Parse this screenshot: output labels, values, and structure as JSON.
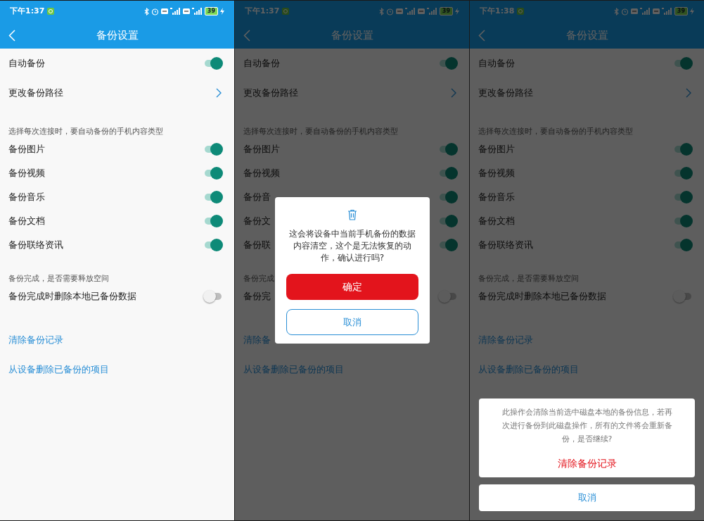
{
  "screens": [
    {
      "status_bar": {
        "time": "下午1:37",
        "icons": [
          {
            "kind": "bluetooth"
          },
          {
            "kind": "alarm"
          },
          {
            "kind": "hd"
          },
          {
            "kind": "signal"
          },
          {
            "kind": "hd"
          },
          {
            "kind": "signal"
          }
        ],
        "battery": "39"
      },
      "title": "备份设置",
      "dimmed": false,
      "rows": [
        {
          "kind": "toggle",
          "label": "自动备份",
          "on": true
        },
        {
          "kind": "nav",
          "label": "更改备份路径"
        },
        {
          "kind": "caption",
          "label": "选择每次连接时，要自动备份的手机内容类型"
        },
        {
          "kind": "toggle",
          "label": "备份图片",
          "on": true
        },
        {
          "kind": "toggle",
          "label": "备份视频",
          "on": true
        },
        {
          "kind": "toggle",
          "label": "备份音乐",
          "on": true
        },
        {
          "kind": "toggle",
          "label": "备份文档",
          "on": true
        },
        {
          "kind": "toggle",
          "label": "备份联络资讯",
          "on": true
        },
        {
          "kind": "caption",
          "label": "备份完成，是否需要释放空间"
        },
        {
          "kind": "toggle",
          "label": "备份完成时删除本地已备份数据",
          "on": false
        },
        {
          "kind": "action",
          "label": "清除备份记录"
        },
        {
          "kind": "action",
          "label": "从设备删除已备份的项目"
        }
      ],
      "overlay": {
        "kind": "none"
      }
    },
    {
      "status_bar": {
        "time": "下午1:37",
        "icons": [
          {
            "kind": "bluetooth"
          },
          {
            "kind": "alarm"
          },
          {
            "kind": "hd"
          },
          {
            "kind": "signal"
          },
          {
            "kind": "hd"
          },
          {
            "kind": "signal"
          }
        ],
        "battery": "39"
      },
      "title": "备份设置",
      "dimmed": true,
      "rows": [
        {
          "kind": "toggle",
          "label": "自动备份",
          "on": true
        },
        {
          "kind": "nav",
          "label": "更改备份路径"
        },
        {
          "kind": "caption",
          "label": "选择每次连接时，要自动备份的手机内容类型"
        },
        {
          "kind": "toggle",
          "label": "备份图片",
          "on": true
        },
        {
          "kind": "toggle",
          "label": "备份视频",
          "on": true
        },
        {
          "kind": "toggle",
          "label": "备份音",
          "on": true
        },
        {
          "kind": "toggle",
          "label": "备份文",
          "on": true
        },
        {
          "kind": "toggle",
          "label": "备份联",
          "on": true
        },
        {
          "kind": "caption",
          "label": "备份完成"
        },
        {
          "kind": "toggle",
          "label": "备份完",
          "on": false
        },
        {
          "kind": "action",
          "label": "清除备"
        },
        {
          "kind": "action",
          "label": "从设备删除已备份的项目"
        }
      ],
      "overlay": {
        "kind": "dialog",
        "message": "这会将设备中当前手机备份的数据内容清空，这个是无法恢复的动作，确认进行吗?",
        "confirm": "确定",
        "cancel": "取消"
      }
    },
    {
      "status_bar": {
        "time": "下午1:38",
        "icons": [
          {
            "kind": "bluetooth"
          },
          {
            "kind": "alarm"
          },
          {
            "kind": "hd"
          },
          {
            "kind": "signal"
          },
          {
            "kind": "hd"
          },
          {
            "kind": "signal"
          }
        ],
        "battery": "39"
      },
      "title": "备份设置",
      "dimmed": true,
      "rows": [
        {
          "kind": "toggle",
          "label": "自动备份",
          "on": true
        },
        {
          "kind": "nav",
          "label": "更改备份路径"
        },
        {
          "kind": "caption",
          "label": "选择每次连接时，要自动备份的手机内容类型"
        },
        {
          "kind": "toggle",
          "label": "备份图片",
          "on": true
        },
        {
          "kind": "toggle",
          "label": "备份视频",
          "on": true
        },
        {
          "kind": "toggle",
          "label": "备份音乐",
          "on": true
        },
        {
          "kind": "toggle",
          "label": "备份文档",
          "on": true
        },
        {
          "kind": "toggle",
          "label": "备份联络资讯",
          "on": true
        },
        {
          "kind": "caption",
          "label": "备份完成，是否需要释放空间"
        },
        {
          "kind": "toggle",
          "label": "备份完成时删除本地已备份数据",
          "on": false
        },
        {
          "kind": "action",
          "label": "清除备份记录"
        },
        {
          "kind": "action",
          "label": "从设备删除已备份的项目"
        }
      ],
      "overlay": {
        "kind": "sheet",
        "message": "此操作会清除当前选中磁盘本地的备份信息，若再次进行备份到此磁盘操作，所有的文件将会重新备份，是否继续?",
        "confirm": "清除备份记录",
        "cancel": "取消"
      }
    }
  ]
}
